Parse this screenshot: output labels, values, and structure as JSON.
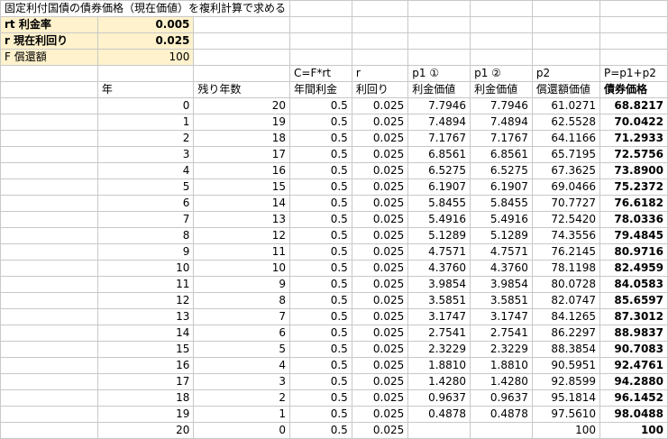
{
  "title": "固定利付国債の債券価格（現在価値）を複利計算で求める",
  "params": [
    {
      "label": "rt 利金率",
      "value": "0.005",
      "bold": true
    },
    {
      "label": "r 現在利回り",
      "value": "0.025",
      "bold": true
    },
    {
      "label": "F 償還額",
      "value": "100",
      "bold": false
    }
  ],
  "formula_row": [
    "",
    "",
    "C=F*rt",
    "r",
    "p1 ①",
    "p1 ②",
    "p2",
    "P=p1+p2"
  ],
  "header_row": [
    "年",
    "残り年数",
    "年間利金",
    "利回り",
    "利金価値",
    "利金価値",
    "償還額価値",
    "債券価格"
  ],
  "rows": [
    [
      "0",
      "20",
      "0.5",
      "0.025",
      "7.7946",
      "7.7946",
      "61.0271",
      "68.8217"
    ],
    [
      "1",
      "19",
      "0.5",
      "0.025",
      "7.4894",
      "7.4894",
      "62.5528",
      "70.0422"
    ],
    [
      "2",
      "18",
      "0.5",
      "0.025",
      "7.1767",
      "7.1767",
      "64.1166",
      "71.2933"
    ],
    [
      "3",
      "17",
      "0.5",
      "0.025",
      "6.8561",
      "6.8561",
      "65.7195",
      "72.5756"
    ],
    [
      "4",
      "16",
      "0.5",
      "0.025",
      "6.5275",
      "6.5275",
      "67.3625",
      "73.8900"
    ],
    [
      "5",
      "15",
      "0.5",
      "0.025",
      "6.1907",
      "6.1907",
      "69.0466",
      "75.2372"
    ],
    [
      "6",
      "14",
      "0.5",
      "0.025",
      "5.8455",
      "5.8455",
      "70.7727",
      "76.6182"
    ],
    [
      "7",
      "13",
      "0.5",
      "0.025",
      "5.4916",
      "5.4916",
      "72.5420",
      "78.0336"
    ],
    [
      "8",
      "12",
      "0.5",
      "0.025",
      "5.1289",
      "5.1289",
      "74.3556",
      "79.4845"
    ],
    [
      "9",
      "11",
      "0.5",
      "0.025",
      "4.7571",
      "4.7571",
      "76.2145",
      "80.9716"
    ],
    [
      "10",
      "10",
      "0.5",
      "0.025",
      "4.3760",
      "4.3760",
      "78.1198",
      "82.4959"
    ],
    [
      "11",
      "9",
      "0.5",
      "0.025",
      "3.9854",
      "3.9854",
      "80.0728",
      "84.0583"
    ],
    [
      "12",
      "8",
      "0.5",
      "0.025",
      "3.5851",
      "3.5851",
      "82.0747",
      "85.6597"
    ],
    [
      "13",
      "7",
      "0.5",
      "0.025",
      "3.1747",
      "3.1747",
      "84.1265",
      "87.3012"
    ],
    [
      "14",
      "6",
      "0.5",
      "0.025",
      "2.7541",
      "2.7541",
      "86.2297",
      "88.9837"
    ],
    [
      "15",
      "5",
      "0.5",
      "0.025",
      "2.3229",
      "2.3229",
      "88.3854",
      "90.7083"
    ],
    [
      "16",
      "4",
      "0.5",
      "0.025",
      "1.8810",
      "1.8810",
      "90.5951",
      "92.4761"
    ],
    [
      "17",
      "3",
      "0.5",
      "0.025",
      "1.4280",
      "1.4280",
      "92.8599",
      "94.2880"
    ],
    [
      "18",
      "2",
      "0.5",
      "0.025",
      "0.9637",
      "0.9637",
      "95.1814",
      "96.1452"
    ],
    [
      "19",
      "1",
      "0.5",
      "0.025",
      "0.4878",
      "0.4878",
      "97.5610",
      "98.0488"
    ],
    [
      "20",
      "0",
      "0.5",
      "0.025",
      "",
      "",
      "100",
      "100"
    ]
  ]
}
